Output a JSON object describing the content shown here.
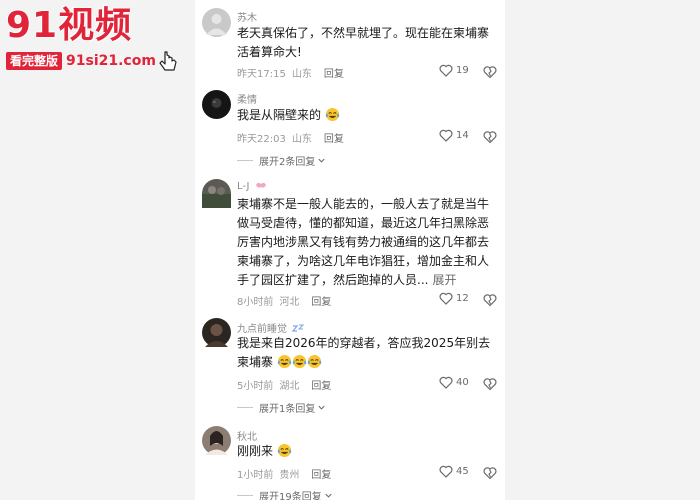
{
  "watermark": {
    "logo": "91视频",
    "badge": "看完整版",
    "url": "91si21.com"
  },
  "comments": [
    {
      "name": "苏木",
      "text": "老天真保佑了，不然早就埋了。现在能在柬埔寨活着算命大!",
      "time": "昨天17:15",
      "location": "山东",
      "reply": "回复",
      "likes": "19",
      "avatar_color": "#c9c9c9"
    },
    {
      "name": "柔情",
      "text": "我是从隔壁来的",
      "time": "昨天22:03",
      "location": "山东",
      "reply": "回复",
      "likes": "14",
      "expand": "展开2条回复",
      "avatar_color": "#151515"
    },
    {
      "name": "L-J",
      "text": "柬埔寨不是一般人能去的，一般人去了就是当牛做马受虐待，懂的都知道，最近这几年扫黑除恶厉害内地涉黑又有钱有势力被通缉的这几年都去柬埔寨了，为啥这几年电诈猖狂，增加金主和人手了园区扩建了，然后跑掉的人员...",
      "more": "展开",
      "time": "8小时前",
      "location": "河北",
      "reply": "回复",
      "likes": "12",
      "avatar_color": "#5d5a55"
    },
    {
      "name": "九点前睡觉",
      "text": "我是来自2026年的穿越者，答应我2025年别去柬埔寨",
      "time": "5小时前",
      "location": "湖北",
      "reply": "回复",
      "likes": "40",
      "expand": "展开1条回复",
      "avatar_color": "#2c2520"
    },
    {
      "name": "秋北",
      "text": "刚刚来",
      "time": "1小时前",
      "location": "贵州",
      "reply": "回复",
      "likes": "45",
      "expand": "展开19条回复",
      "avatar_color": "#8c7e72"
    }
  ],
  "icons": [
    "heart-icon",
    "dislike-icon",
    "chevron-down-icon",
    "laugh-cry-emoji",
    "cursor-icon"
  ],
  "colors": {
    "brand_red": "#e0243a",
    "text": "#1a1a1a",
    "muted": "#9a9a9a",
    "panel_bg": "#ffffff"
  }
}
